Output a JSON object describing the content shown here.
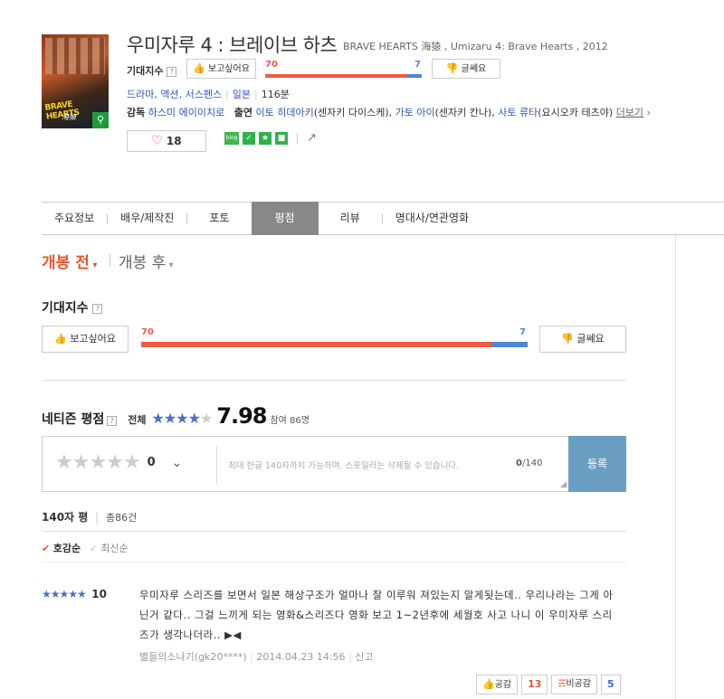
{
  "movie": {
    "title": "우미자루 4 : 브레이브 하츠",
    "original_title": "BRAVE HEARTS 海猿 , Umizaru 4: Brave Hearts , 2012",
    "poster_title": "BRAVE HEARTS",
    "poster_sub": "海猿",
    "expect_label": "기대지수",
    "help_mark": "?",
    "want_btn": "보고싶어요",
    "want_value": 70,
    "meh_btn": "글쎄요",
    "meh_value": 7,
    "genres": "드라마, 액션, 서스펜스",
    "country": "일본",
    "runtime": "116분",
    "director_label": "감독",
    "director": "하스미 에이이치로",
    "cast_label": "출연",
    "cast1": "이토 히데아키",
    "cast1_role": "(센자키 다이스케),",
    "cast2": "가토 아이",
    "cast2_role": "(센자키 칸나),",
    "cast3": "사토 류타",
    "cast3_role": "(요시오카 테츠야)",
    "more": "더보기",
    "likes": "18"
  },
  "tabs": [
    "주요정보",
    "배우/제작진",
    "포토",
    "평점",
    "리뷰",
    "명대사/연관영화"
  ],
  "subtabs": {
    "before": "개봉 전",
    "after": "개봉 후"
  },
  "expect_section": {
    "heading": "기대지수",
    "want_btn": "보고싶어요",
    "want_value": 70,
    "meh_btn": "글쎄요",
    "meh_value": 7
  },
  "netizen": {
    "heading": "네티즌 평점",
    "scope": "전체",
    "score": "7.98",
    "participants": "참여 86명",
    "star_fill": 0.798
  },
  "rate_form": {
    "score": "0",
    "placeholder": "최대 한글 140자까지 가능하며, 스포일러는 삭제될 수 있습니다.",
    "counter_current": "0",
    "counter_total": "/140",
    "submit": "등록"
  },
  "reviews_header": {
    "title": "140자 평",
    "total": "총86건"
  },
  "sort": {
    "active": "호감순",
    "other": "최신순"
  },
  "review": {
    "score": "10",
    "text": "우미자루 스리즈를 보면서 일본 해상구조가 얼마나 잘 이루워 져있는지 알게됫는데.. 우리나라는 그게 아닌거 같다.. 그걸 느끼게 되는 영화&스리즈다 영화 보고 1~2년후에 세월호 사고 나니 이 우미자루 스리즈가 생각나더라.. ▶◀",
    "author": "별들의소나기(gk20****)",
    "date": "2014.04.23 14:56",
    "report": "신고",
    "agree": "공감",
    "agree_count": "13",
    "disagree": "비공감",
    "disagree_count": "5"
  },
  "colors": {
    "accent": "#e8552e",
    "blue": "#4e86d8",
    "submit": "#6a9fc3"
  }
}
